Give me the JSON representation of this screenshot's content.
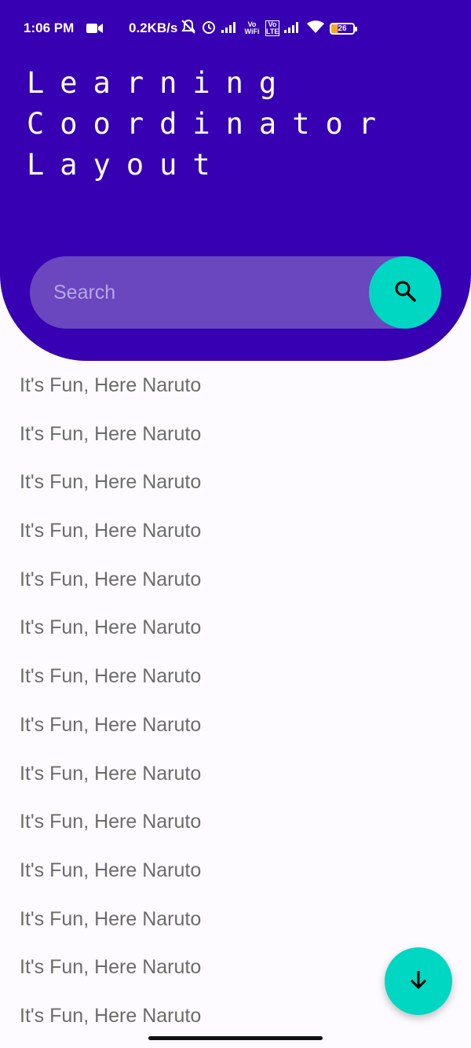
{
  "status_bar": {
    "time": "1:06 PM",
    "network_speed": "0.2KB/s",
    "volte_wifi_label": "Vo WiFi",
    "volte_lte_label": "Vo LTE",
    "battery": "26"
  },
  "header": {
    "title_lines": [
      "Learning",
      "Coordinator",
      "Layout"
    ],
    "background_color": "#3700b3"
  },
  "search": {
    "placeholder": "Search",
    "value": "",
    "button_icon": "search-icon",
    "accent_color": "#00d7c2"
  },
  "list": {
    "items": [
      "It's Fun, Here Naruto",
      "It's Fun, Here Naruto",
      "It's Fun, Here Naruto",
      "It's Fun, Here Naruto",
      "It's Fun, Here Naruto",
      "It's Fun, Here Naruto",
      "It's Fun, Here Naruto",
      "It's Fun, Here Naruto",
      "It's Fun, Here Naruto",
      "It's Fun, Here Naruto",
      "It's Fun, Here Naruto",
      "It's Fun, Here Naruto",
      "It's Fun, Here Naruto",
      "It's Fun, Here Naruto"
    ]
  },
  "fab": {
    "icon": "arrow-down-icon"
  }
}
